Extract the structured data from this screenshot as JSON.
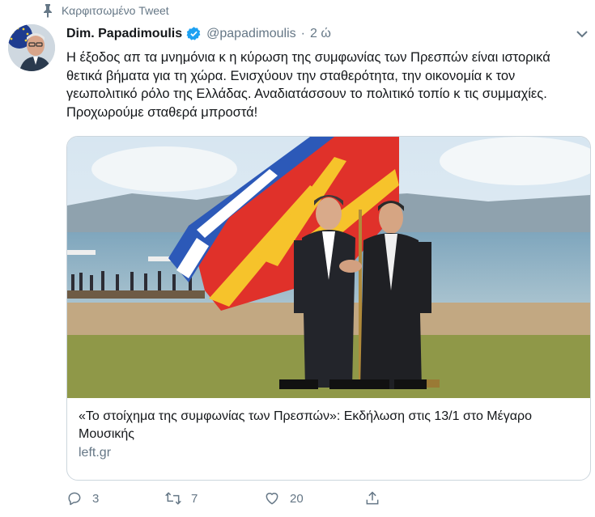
{
  "pinned": {
    "label": "Καρφιτσωμένο Tweet",
    "icon": "pin-icon"
  },
  "author": {
    "name": "Dim. Papadimoulis",
    "handle": "@papadimoulis",
    "separator": "·",
    "time": "2 ώ",
    "verified_icon": "verified-badge-icon",
    "verified_color": "#1da1f2"
  },
  "tweet": {
    "text": "Η έξοδος απ τα μνημόνια κ η κύρωση της συμφωνίας των Πρεσπών είναι ιστορικά θετικά βήματα για τη χώρα. Ενισχύουν την σταθερότητα, την οικονομία κ τον γεωπολιτικό ρόλο της Ελλάδας. Αναδιατάσσουν το πολιτικό τοπίο κ τις συμμαχίες. Προχωρούμε σταθερά μπροστά!"
  },
  "card": {
    "title": "«Το στοίχημα της συμφωνίας των Πρεσπών»: Εκδήλωση στις 13/1 στο Μέγαρο Μουσικής",
    "domain": "left.gr"
  },
  "actions": {
    "reply_count": "3",
    "retweet_count": "7",
    "like_count": "20"
  },
  "colors": {
    "secondary_text": "#657786",
    "border": "#ccd6dd",
    "text": "#14171a"
  }
}
